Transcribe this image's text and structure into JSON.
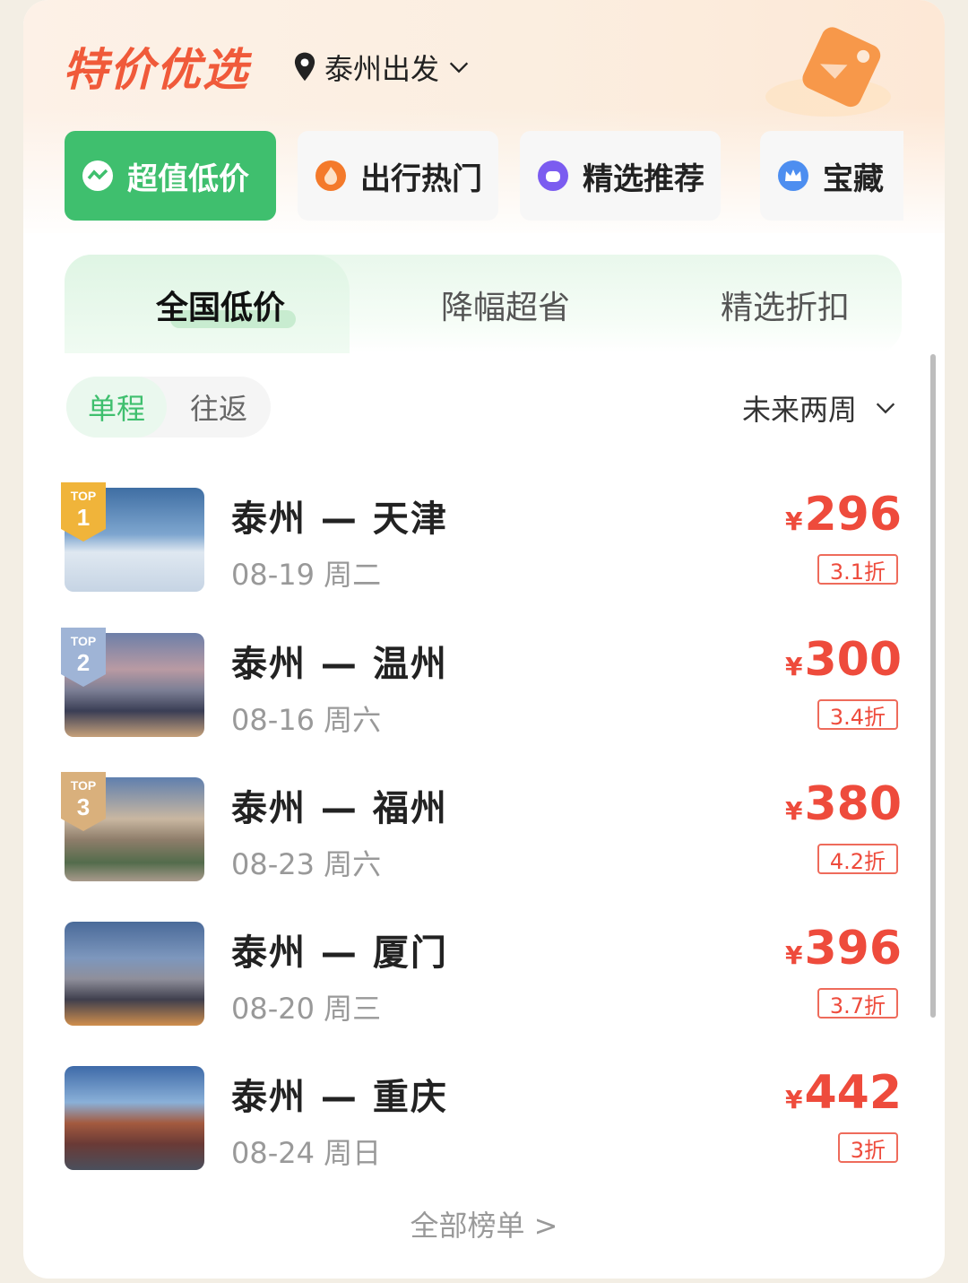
{
  "header": {
    "title": "特价优选",
    "departure": "泰州出发"
  },
  "categories": [
    {
      "label": "超值低价",
      "icon": "low-price-icon",
      "active": true,
      "color": "#3fbf6e"
    },
    {
      "label": "出行热门",
      "icon": "flame-icon",
      "active": false,
      "color": "#f47a2b"
    },
    {
      "label": "精选推荐",
      "icon": "thumb-up-icon",
      "active": false,
      "color": "#7b5cf0"
    },
    {
      "label": "宝藏",
      "icon": "crown-icon",
      "active": false,
      "color": "#4d8ef0"
    }
  ],
  "sub_tabs": [
    "全国低价",
    "降幅超省",
    "精选折扣"
  ],
  "trip_type": {
    "one_way": "单程",
    "round_trip": "往返",
    "selected": "单程"
  },
  "date_range": "未来两周",
  "routes": [
    {
      "rank": "1",
      "top_label": "TOP",
      "title": "泰州 — 天津",
      "date": "08-19 周二",
      "currency": "¥",
      "price": "296",
      "discount": "3.1折"
    },
    {
      "rank": "2",
      "top_label": "TOP",
      "title": "泰州 — 温州",
      "date": "08-16 周六",
      "currency": "¥",
      "price": "300",
      "discount": "3.4折"
    },
    {
      "rank": "3",
      "top_label": "TOP",
      "title": "泰州 — 福州",
      "date": "08-23 周六",
      "currency": "¥",
      "price": "380",
      "discount": "4.2折"
    },
    {
      "title": "泰州 — 厦门",
      "date": "08-20 周三",
      "currency": "¥",
      "price": "396",
      "discount": "3.7折"
    },
    {
      "title": "泰州 — 重庆",
      "date": "08-24 周日",
      "currency": "¥",
      "price": "442",
      "discount": "3折"
    }
  ],
  "footer_link": "全部榜单 >"
}
